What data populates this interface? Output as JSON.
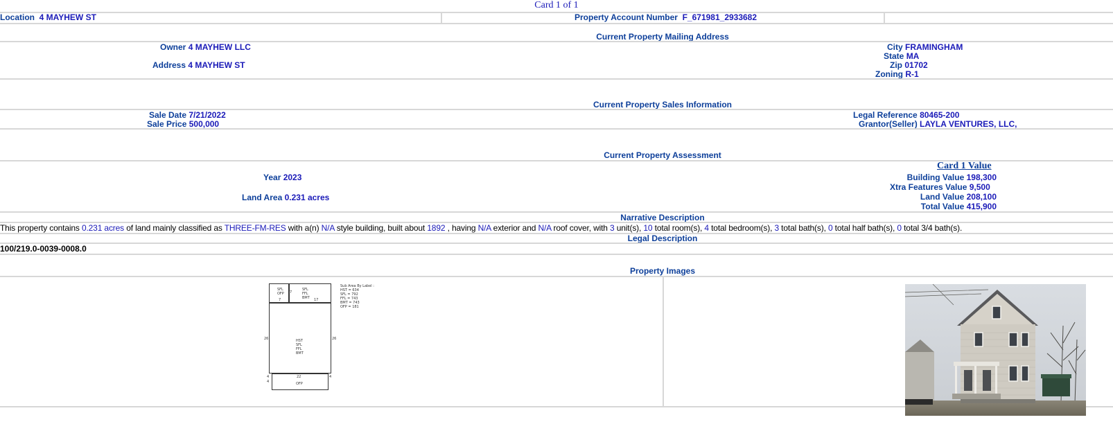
{
  "card_title": "Card 1 of 1",
  "location": {
    "label": "Location",
    "value": "4 MAYHEW ST"
  },
  "account": {
    "label": "Property Account Number",
    "value": "F_671981_2933682"
  },
  "mailing": {
    "heading": "Current Property Mailing Address",
    "owner_label": "Owner",
    "owner": "4 MAYHEW LLC",
    "address_label": "Address",
    "address": "4 MAYHEW ST",
    "city_label": "City",
    "city": "FRAMINGHAM",
    "state_label": "State",
    "state": "MA",
    "zip_label": "Zip",
    "zip": "01702",
    "zoning_label": "Zoning",
    "zoning": "R-1"
  },
  "sales": {
    "heading": "Current Property Sales Information",
    "sale_date_label": "Sale Date",
    "sale_date": "7/21/2022",
    "sale_price_label": "Sale Price",
    "sale_price": "500,000",
    "legal_ref_label": "Legal Reference",
    "legal_ref": "80465-200",
    "grantor_label": "Grantor(Seller)",
    "grantor": "LAYLA VENTURES, LLC,"
  },
  "assessment": {
    "heading": "Current Property Assessment",
    "year_label": "Year",
    "year": "2023",
    "land_area_label": "Land Area",
    "land_area": "0.231 acres",
    "card_value_heading": "Card 1 Value",
    "building_label": "Building Value",
    "building": "198,300",
    "xtra_label": "Xtra Features Value",
    "xtra": "9,500",
    "land_label": "Land Value",
    "land": "208,100",
    "total_label": "Total Value",
    "total": "415,900"
  },
  "narrative": {
    "heading": "Narrative Description",
    "t1": "This property contains ",
    "acres": "0.231 acres",
    "t2": " of land mainly classified as ",
    "class": "THREE-FM-RES",
    "t3": " with a(n) ",
    "style": "N/A",
    "t4": " style building, built about ",
    "year_built": "1892",
    "t5": " , having ",
    "exterior": "N/A",
    "t6": " exterior and ",
    "roof": "N/A",
    "t7": " roof cover, with ",
    "units": "3",
    "t8": " unit(s), ",
    "rooms": "10",
    "t9": " total room(s), ",
    "bedrooms": "4",
    "t10": " total bedroom(s), ",
    "baths": "3",
    "t11": " total bath(s), ",
    "half_baths": "0",
    "t12": " total half bath(s), ",
    "three_quarter_baths": "0",
    "t13": " total 3/4 bath(s)."
  },
  "legal": {
    "heading": "Legal Description",
    "text": "100/219.0-0039-0008.0"
  },
  "images": {
    "heading": "Property Images"
  },
  "sketch": {
    "top_left": [
      "SFL",
      "OFP"
    ],
    "top_left_dim_side": "7",
    "top_left_dim_bottom": "7",
    "top_right": [
      "SFL",
      "FFL",
      "BMT"
    ],
    "top_right_dim": "17",
    "main_labels": [
      "HST",
      "SFL",
      "FFL",
      "BMT"
    ],
    "main_left_dim": "26",
    "main_right_dim": "26",
    "bottom_dim_top": "22",
    "bottom_label": "OFP",
    "bottom_side_dim_left": "4",
    "bottom_side_dim_left2": "4",
    "bottom_side_dim_right": "4",
    "legend": [
      "Sub Area By Label :",
      "HST = 634",
      "SFL = 792",
      "FFL = 743",
      "BMT = 743",
      "OFP = 181"
    ]
  },
  "colors": {
    "label": "#0d3f9a",
    "value": "#1a1ab8",
    "rule": "#d7d7d7"
  }
}
